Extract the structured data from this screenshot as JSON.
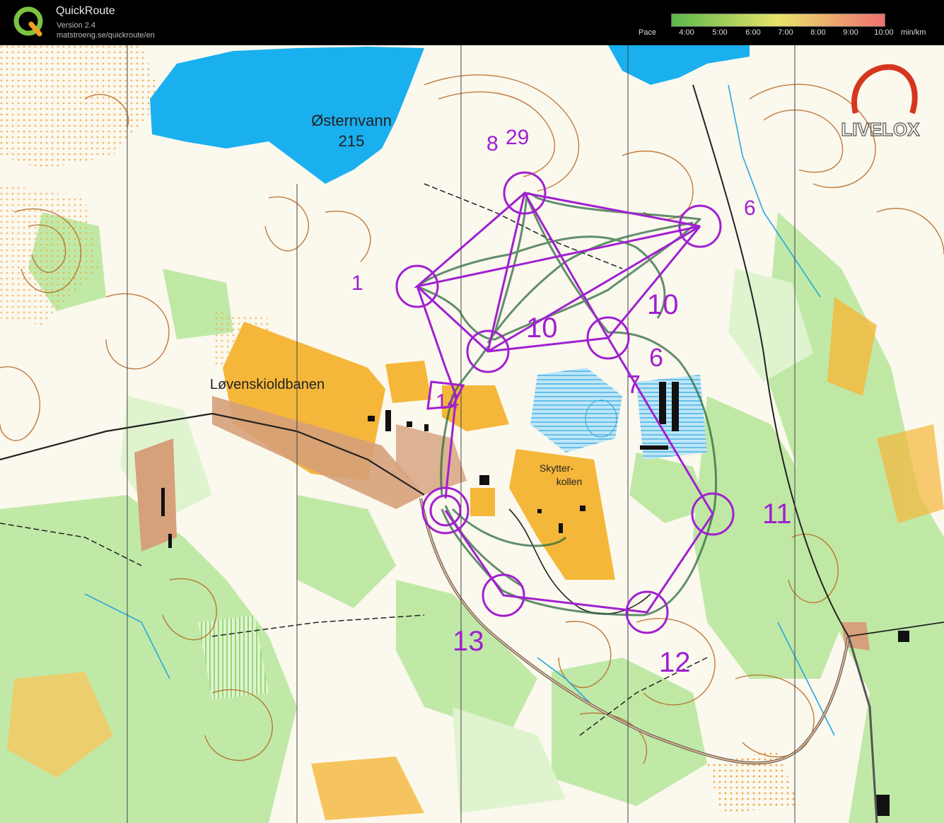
{
  "app": {
    "title": "QuickRoute",
    "version": "Version 2.4",
    "url": "matstroeng.se/quickroute/en"
  },
  "pace_scale": {
    "label": "Pace",
    "ticks": [
      "4:00",
      "5:00",
      "6:00",
      "7:00",
      "8:00",
      "9:00",
      "10:00"
    ],
    "unit": "min/km",
    "color_from": "#5cb84a",
    "color_mid": "#e8e36a",
    "color_to": "#f07070"
  },
  "map": {
    "lake_name": "Østernvann",
    "lake_height": "215",
    "place_lovenskiold": "Løvenskioldbanen",
    "place_skytter_1": "Skytter-",
    "place_skytter_2": "kollen",
    "watermark": "LIVELOX",
    "colors": {
      "course": "#a020d0",
      "route": "#2e6b3f",
      "lake": "#1ab0ef",
      "open": "#f5b73a",
      "forest": "#b8e69a",
      "building": "#d6a07a"
    }
  },
  "course_labels": {
    "c8a": "8",
    "c29": "29",
    "c1": "1",
    "c6": "6",
    "c10a": "10",
    "c10b": "10",
    "c6b": "6",
    "c7": "7",
    "c11": "11",
    "c12": "12",
    "c13": "13",
    "c4": "14"
  }
}
